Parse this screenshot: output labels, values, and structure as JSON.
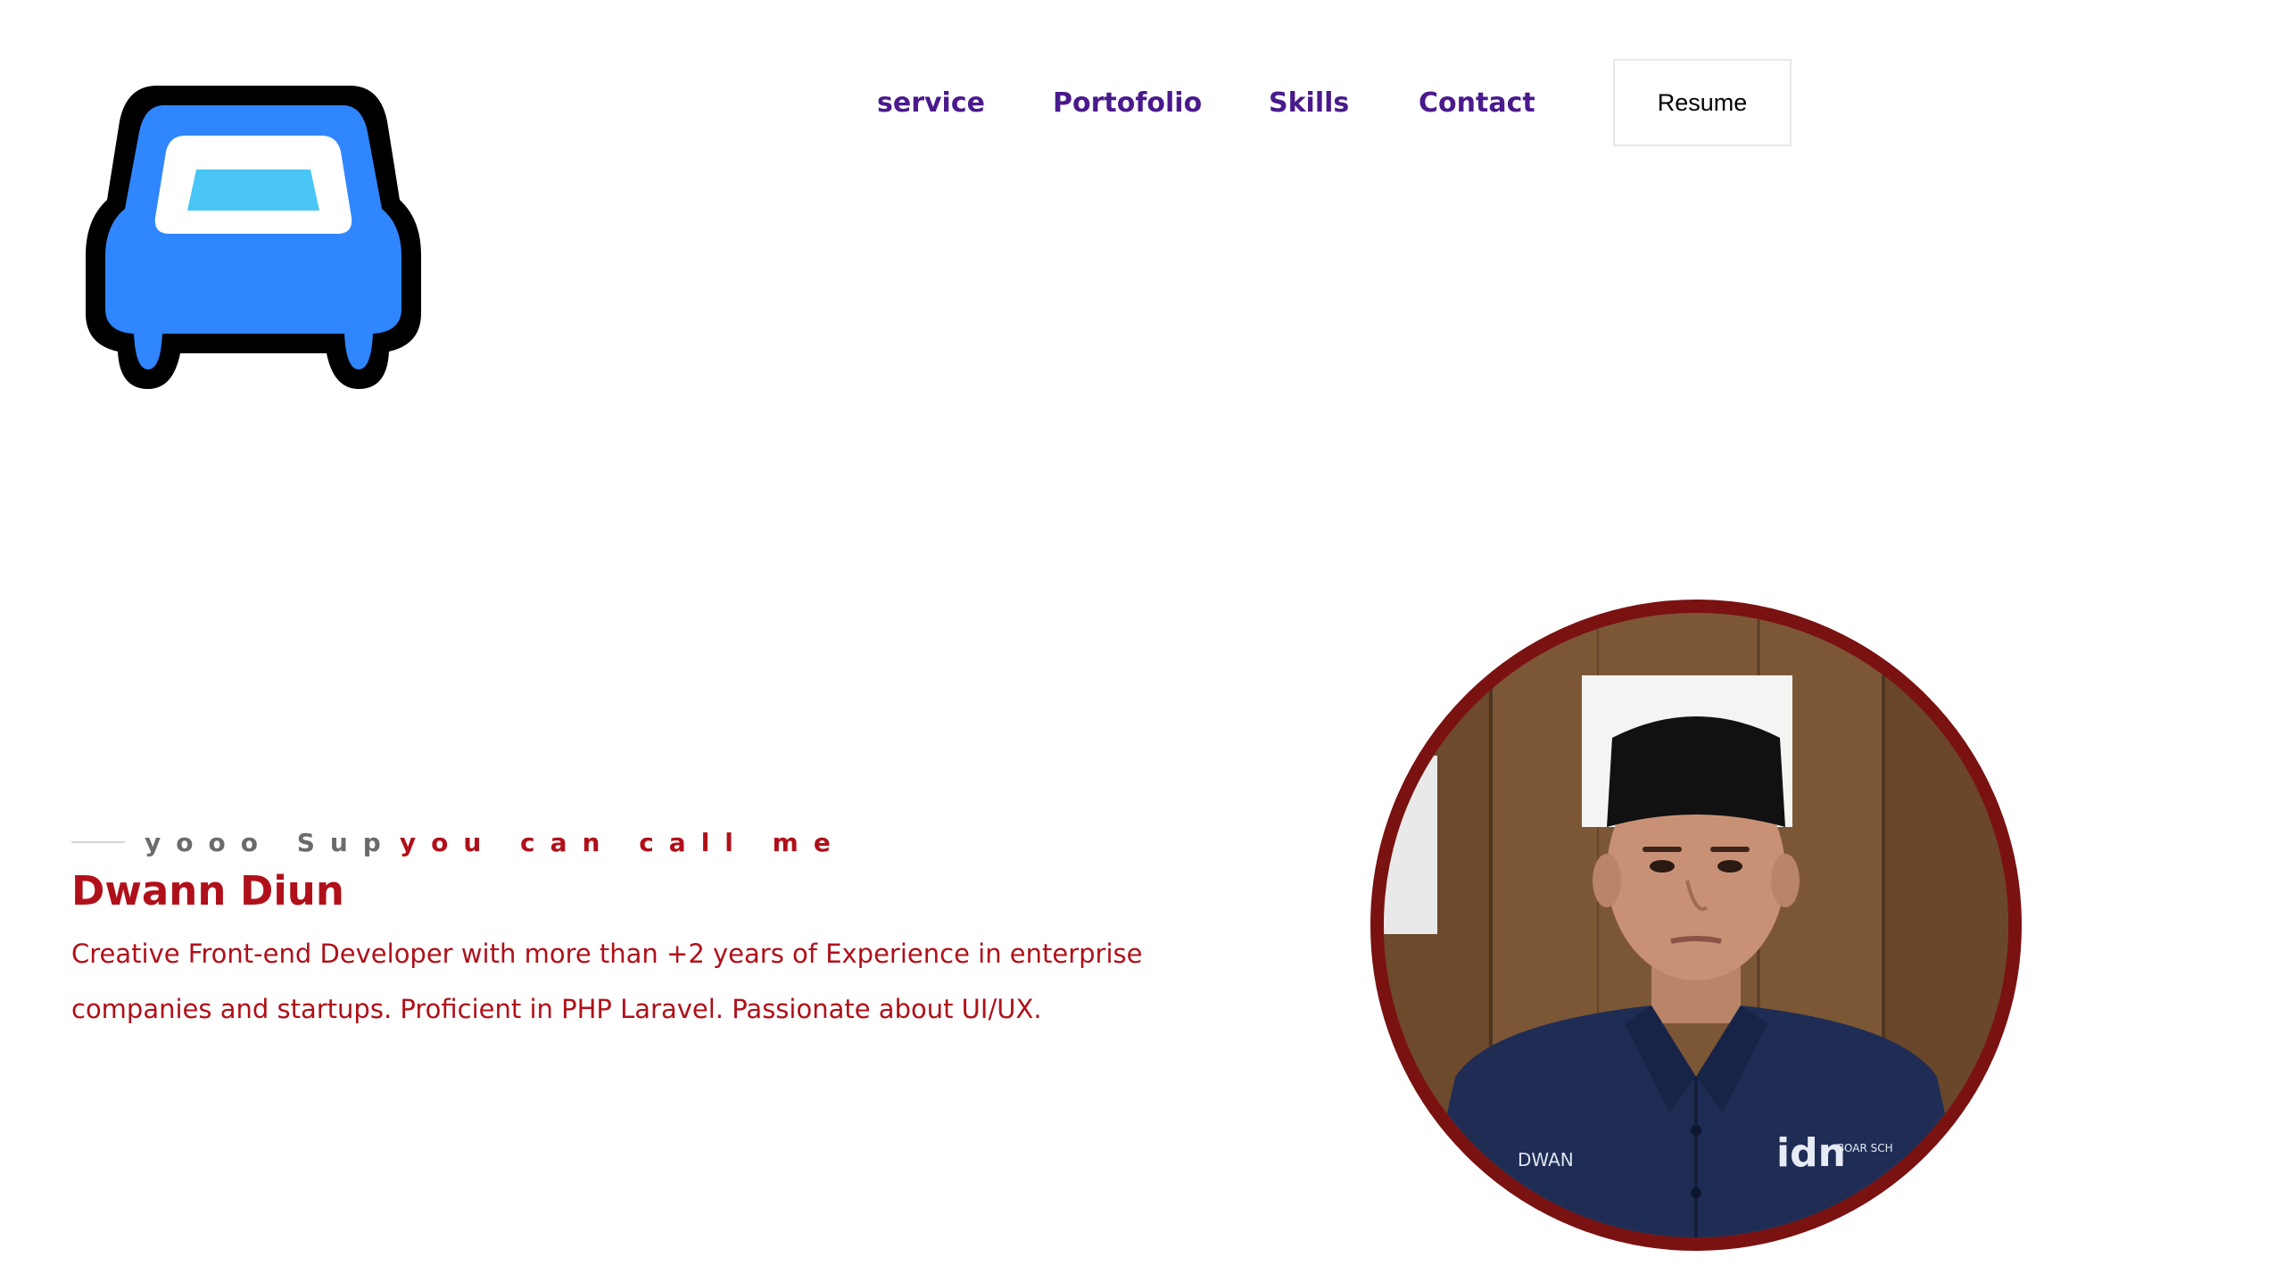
{
  "logo": {
    "icon": "car-icon",
    "colors": {
      "outline": "#000000",
      "body": "#2f86ff",
      "window_frame": "#ffffff",
      "window_glass": "#49c6f5"
    }
  },
  "nav": {
    "items": [
      {
        "label": "service"
      },
      {
        "label": "Portofolio"
      },
      {
        "label": "Skills"
      },
      {
        "label": "Contact"
      }
    ],
    "resume_label": "Resume"
  },
  "hero": {
    "tagline_grey": "yooo Sup",
    "tagline_red": "you can call me",
    "name": "Dwann Diun",
    "description": "Creative Front-end Developer with more than +2 years of Experience in enterprise companies and startups. Proficient in PHP Laravel. Passionate about UI/UX."
  },
  "portrait": {
    "border_color": "#7a1212",
    "badge_name": "DWAN",
    "badge_logo": "idn",
    "badge_logo_sub": "BOAR SCH"
  },
  "colors": {
    "accent_red": "#b0101a",
    "nav_purple": "#4a1a8c",
    "tagline_grey": "#6b6b6b"
  }
}
